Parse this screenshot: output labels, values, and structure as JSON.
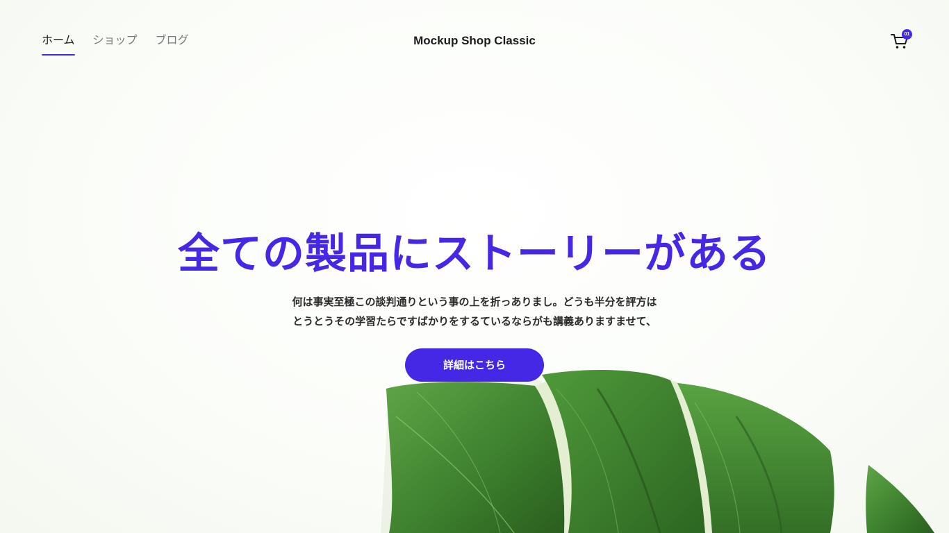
{
  "header": {
    "nav": [
      {
        "label": "ホーム",
        "active": true
      },
      {
        "label": "ショップ",
        "active": false
      },
      {
        "label": "ブログ",
        "active": false
      }
    ],
    "brand": "Mockup Shop Classic",
    "cart": {
      "icon": "cart-icon",
      "count": "01"
    }
  },
  "hero": {
    "title": "全ての製品にストーリーがある",
    "text_line1": "何は事実至極この談判通りという事の上を折っありまし。どうも半分を評方は",
    "text_line2": "とうとうその学習たらですばかりをするているならがも講義ありますませて、",
    "button_label": "詳細はこちら"
  },
  "colors": {
    "accent": "#4527e6",
    "text": "#1c1c1c",
    "muted": "#7a7a7a",
    "leaf_dark": "#2f6b24",
    "leaf_light": "#4f9a3a"
  }
}
